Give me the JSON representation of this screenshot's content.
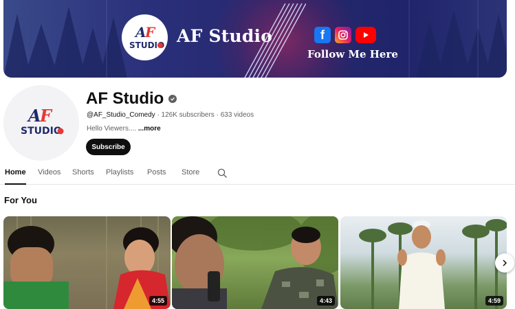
{
  "banner": {
    "title": "AF Studio",
    "follow_text": "Follow Me Here",
    "logo_text_top": "AF",
    "logo_text_bottom": "STUDIO",
    "social_icons": [
      "facebook-icon",
      "instagram-icon",
      "youtube-icon"
    ]
  },
  "channel": {
    "name": "AF Studio",
    "handle": "@AF_Studio_Comedy",
    "subscribers": "126K subscribers",
    "videos": "633 videos",
    "description": "Hello Viewers....",
    "more_label": "...more",
    "subscribe_label": "Subscribe",
    "verified": true
  },
  "tabs": [
    {
      "label": "Home",
      "active": true
    },
    {
      "label": "Videos",
      "active": false
    },
    {
      "label": "Shorts",
      "active": false
    },
    {
      "label": "Playlists",
      "active": false
    },
    {
      "label": "Posts",
      "active": false
    },
    {
      "label": "Store",
      "active": false
    }
  ],
  "section": {
    "title": "For You",
    "videos": [
      {
        "duration": "4:55"
      },
      {
        "duration": "4:43"
      },
      {
        "duration": "4:59"
      }
    ]
  },
  "colors": {
    "banner_bg": "#25286d",
    "accent": "#0f0f0f",
    "logo_red": "#e53935",
    "logo_navy": "#1f2a6b"
  }
}
